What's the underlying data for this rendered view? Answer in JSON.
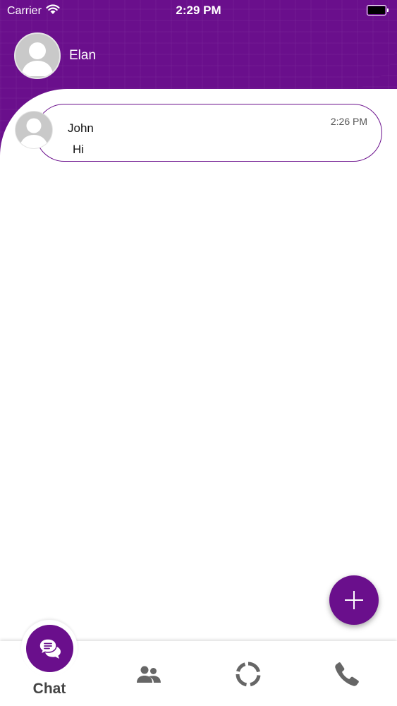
{
  "status_bar": {
    "carrier": "Carrier",
    "time": "2:29 PM"
  },
  "header": {
    "user_name": "Elan"
  },
  "chats": [
    {
      "name": "John",
      "message": "Hi",
      "time": "2:26 PM"
    }
  ],
  "bottom_nav": {
    "items": [
      {
        "label": "Chat",
        "icon": "chat-bubbles-icon",
        "active": true
      },
      {
        "label": "",
        "icon": "contacts-icon",
        "active": false
      },
      {
        "label": "",
        "icon": "status-ring-icon",
        "active": false
      },
      {
        "label": "",
        "icon": "phone-icon",
        "active": false
      }
    ]
  },
  "fab": {
    "icon": "plus-icon"
  },
  "colors": {
    "primary": "#6a0f8c",
    "nav_icon": "#666666"
  }
}
